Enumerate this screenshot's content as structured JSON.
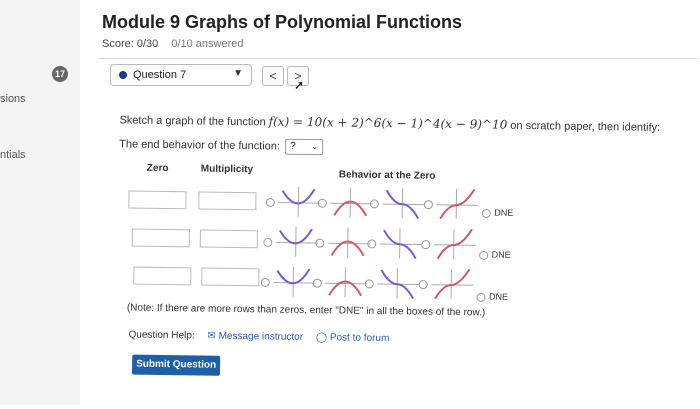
{
  "edge_tabs": [
    "sions",
    "ntials"
  ],
  "header": {
    "title": "Module 9 Graphs of Polynomial Functions",
    "score": "Score: 0/30",
    "answered": "0/10 answered"
  },
  "question": {
    "badge": "17",
    "select_label": "Question 7",
    "prev": "<",
    "next": ">"
  },
  "prompt": {
    "lead": "Sketch a graph of the function",
    "formula": "f(x) = 10(x + 2)^6(x − 1)^4(x − 9)^10",
    "tail": "on scratch paper, then identify:",
    "end_behavior_label": "The end behavior of the function:",
    "end_behavior_value": "?"
  },
  "table": {
    "headers": {
      "zero": "Zero",
      "multiplicity": "Multiplicity",
      "behavior": "Behavior at the Zero"
    },
    "dne_label": "DNE"
  },
  "note": "(Note: If there are more rows than zeros, enter \"DNE\" in all the boxes of the row.)",
  "help": {
    "label": "Question Help:",
    "message": "Message instructor",
    "forum": "Post to forum"
  },
  "submit": "Submit Question"
}
